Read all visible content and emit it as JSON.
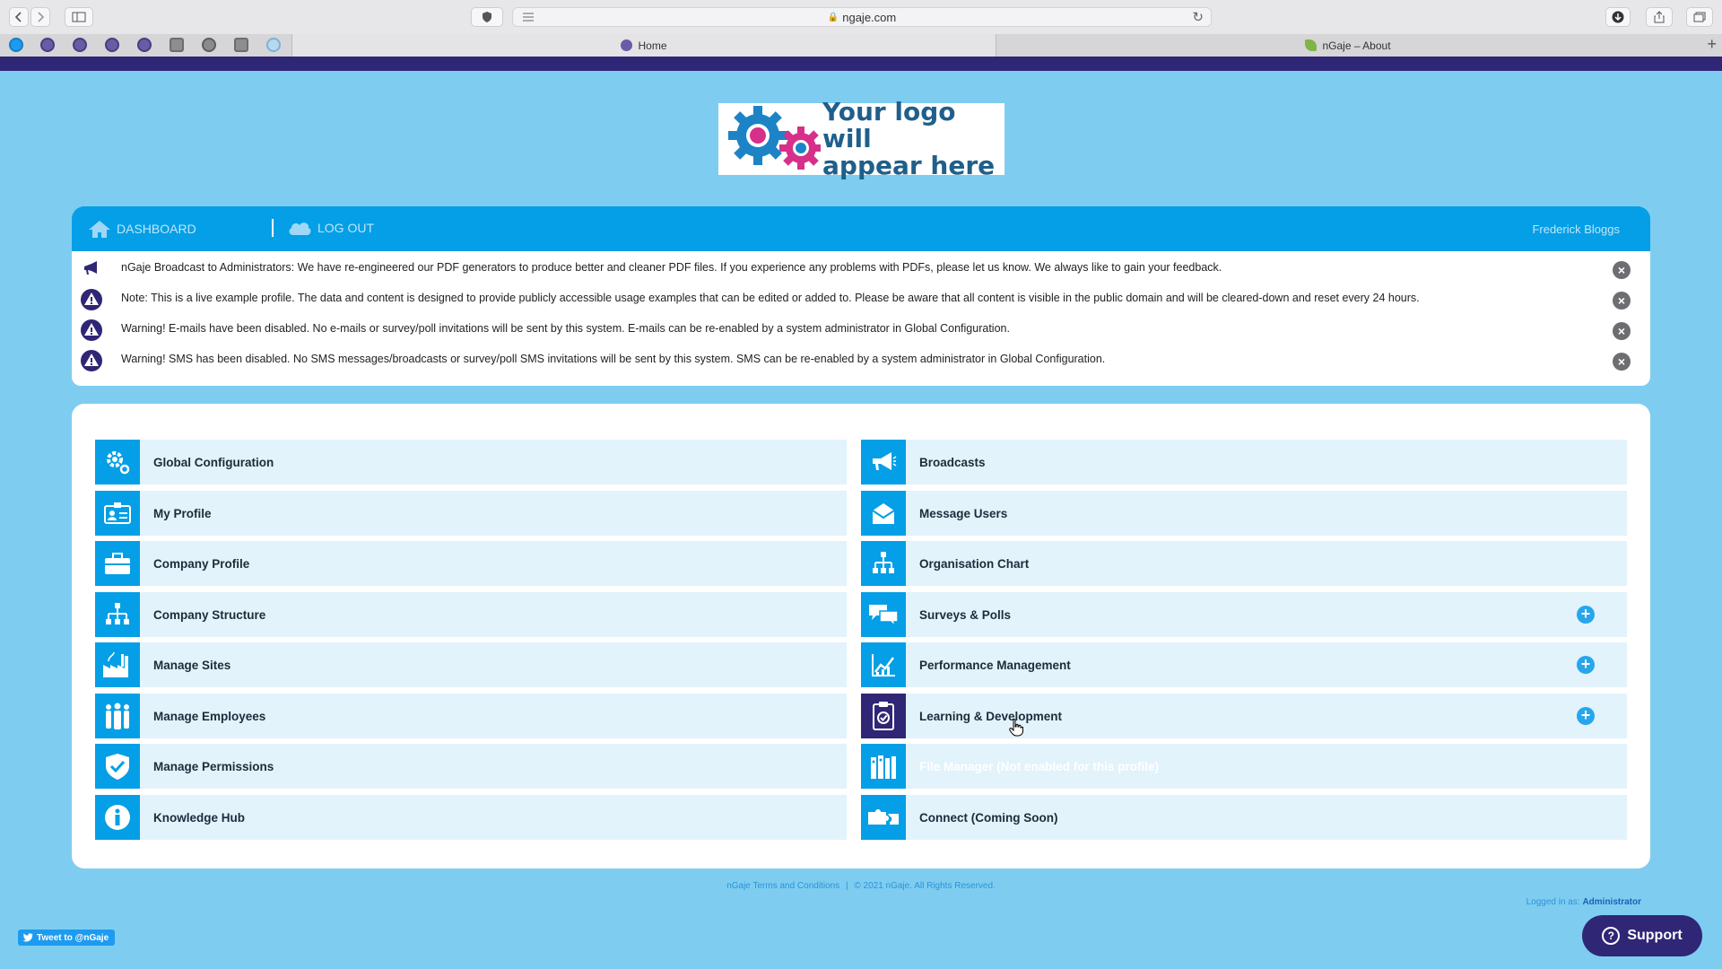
{
  "browser": {
    "url": "ngaje.com",
    "tabs": [
      {
        "title": "Home",
        "active": true
      },
      {
        "title": "nGaje – About",
        "active": false
      }
    ]
  },
  "logo": {
    "text_line1": "Your logo will",
    "text_line2": "appear here"
  },
  "header": {
    "nav": [
      {
        "label": "DASHBOARD",
        "icon": "home-icon"
      },
      {
        "label": "LOG OUT",
        "icon": "cloud-icon"
      }
    ],
    "user_name": "Frederick Bloggs"
  },
  "alerts": [
    {
      "icon": "megaphone-icon",
      "text": "nGaje Broadcast to Administrators: We have re-engineered our PDF generators to produce better and cleaner PDF files. If you experience any problems with PDFs, please let us know. We always like to gain your feedback."
    },
    {
      "icon": "warning-icon",
      "text": "Note: This is a live example profile. The data and content is designed to provide publicly accessible usage examples that can be edited or added to. Please be aware that all content is visible in the public domain and will be cleared-down and reset every 24 hours."
    },
    {
      "icon": "warning-icon",
      "text": "Warning! E-mails have been disabled. No e-mails or survey/poll invitations will be sent by this system. E-mails can be re-enabled by a system administrator in Global Configuration."
    },
    {
      "icon": "warning-icon",
      "text": "Warning! SMS has been disabled. No SMS messages/broadcasts or survey/poll SMS invitations will be sent by this system. SMS can be re-enabled by a system administrator in Global Configuration."
    }
  ],
  "menu": {
    "left": [
      {
        "label": "Global Configuration",
        "icon": "gear-icon"
      },
      {
        "label": "My Profile",
        "icon": "id-card-icon"
      },
      {
        "label": "Company Profile",
        "icon": "briefcase-icon"
      },
      {
        "label": "Company Structure",
        "icon": "hierarchy-icon"
      },
      {
        "label": "Manage Sites",
        "icon": "factory-icon"
      },
      {
        "label": "Manage Employees",
        "icon": "people-icon"
      },
      {
        "label": "Manage Permissions",
        "icon": "shield-check-icon"
      },
      {
        "label": "Knowledge Hub",
        "icon": "info-icon"
      }
    ],
    "right": [
      {
        "label": "Broadcasts",
        "icon": "megaphone-icon",
        "expandable": false
      },
      {
        "label": "Message Users",
        "icon": "envelope-icon",
        "expandable": false
      },
      {
        "label": "Organisation Chart",
        "icon": "org-chart-icon",
        "expandable": false
      },
      {
        "label": "Surveys & Polls",
        "icon": "chat-bubbles-icon",
        "expandable": true
      },
      {
        "label": "Performance Management",
        "icon": "line-chart-icon",
        "expandable": true
      },
      {
        "label": "Learning & Development",
        "icon": "clipboard-check-icon",
        "expandable": true,
        "active": true
      },
      {
        "label": "File Manager (Not enabled for this profile)",
        "icon": "binders-icon",
        "expandable": false,
        "disabled": true
      },
      {
        "label": "Connect (Coming Soon)",
        "icon": "puzzle-icon",
        "expandable": false
      }
    ]
  },
  "footer": {
    "terms": "nGaje Terms and Conditions",
    "separator": "|",
    "copyright": "© 2021 nGaje. All Rights Reserved.",
    "logged_in_label": "Logged in as:",
    "logged_in_user": "Administrator",
    "tweet_label": "Tweet to @nGaje",
    "support_label": "Support"
  },
  "colors": {
    "page_bg": "#7ecdf1",
    "header_blue": "#049fe6",
    "brand_purple": "#2f2676",
    "tile_bg": "#e2f3fc"
  }
}
